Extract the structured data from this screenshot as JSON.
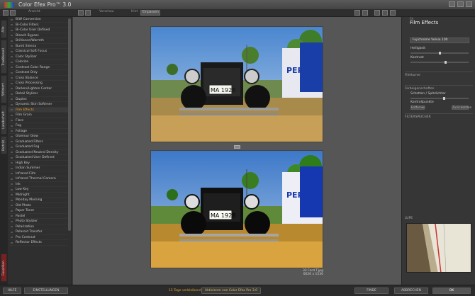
{
  "window": {
    "title": "Color Efex Pro™ 3.0"
  },
  "toolbar": {
    "view_label": "Ansicht",
    "zoom_label": "Vorschau",
    "fit_label": "Hint",
    "fit_value": "Einpassen"
  },
  "sidebar": {
    "tabs": [
      "Alle",
      "Traditionell",
      "Stilisiert",
      "Landschaft",
      "Porträt",
      "Favoriten"
    ],
    "filters": [
      "B/W Conversion",
      "Bi-Color Filters",
      "Bi-Color User Defined",
      "Bleach Bypass",
      "Brilliance/Warmth",
      "Burnt Sienna",
      "Classical Soft Focus",
      "Color Stylizer",
      "Colorize",
      "Contrast Color Range",
      "Contrast Only",
      "Cross Balance",
      "Cross Processing",
      "Darken/Lighten Center",
      "Detail Stylizer",
      "Duplex",
      "Dynamic Skin Softener",
      "Film Effects",
      "Film Grain",
      "Flare",
      "Fog",
      "Foliage",
      "Glamour Glow",
      "Graduated Filters",
      "Graduated Fog",
      "Graduated Neutral Density",
      "Graduated User Defined",
      "High Key",
      "Indian Summer",
      "Infrared Film",
      "Infrared Thermal Camera",
      "Ink",
      "Low Key",
      "Midnight",
      "Monday Morning",
      "Old Photo",
      "Paper Toner",
      "Pastel",
      "Photo Stylizer",
      "Polarization",
      "Polaroid Transfer",
      "Pro Contrast",
      "Reflector Effects"
    ],
    "selected": "Film Effects"
  },
  "canvas": {
    "caption_title": "32 Ford T.jpg",
    "caption_size": "0026 x 1536",
    "photo_text": {
      "brand": "PEPSI",
      "plate": "MA 1928"
    }
  },
  "panel": {
    "small_label": "FX",
    "title": "Film Effects",
    "preset": "Fujichrome Velvia 100",
    "params": [
      "Helligkeit",
      "Kontrast",
      "Filmkurve"
    ],
    "section_control_points": "Farbeigenschaften",
    "section_control_label": "Schatten / Spitzlichter",
    "section_control_label2": "Kontrollpunkte",
    "section_history": "FILTERSPEICHER",
    "lupe_label": "LUPE",
    "btn_a": "Entfernen",
    "btn_b": "Zurücksetzen"
  },
  "bottom": {
    "help": "HILFE",
    "settings": "EINSTELLUNGEN",
    "trial": "15 Tage verbleibend",
    "upgrade": "Aktivieren von Color Efex Pro 3.0",
    "cancel": "ABBRECHEN",
    "apply": "ANWENDEN",
    "ok": "OK",
    "extra": "FINDE"
  }
}
